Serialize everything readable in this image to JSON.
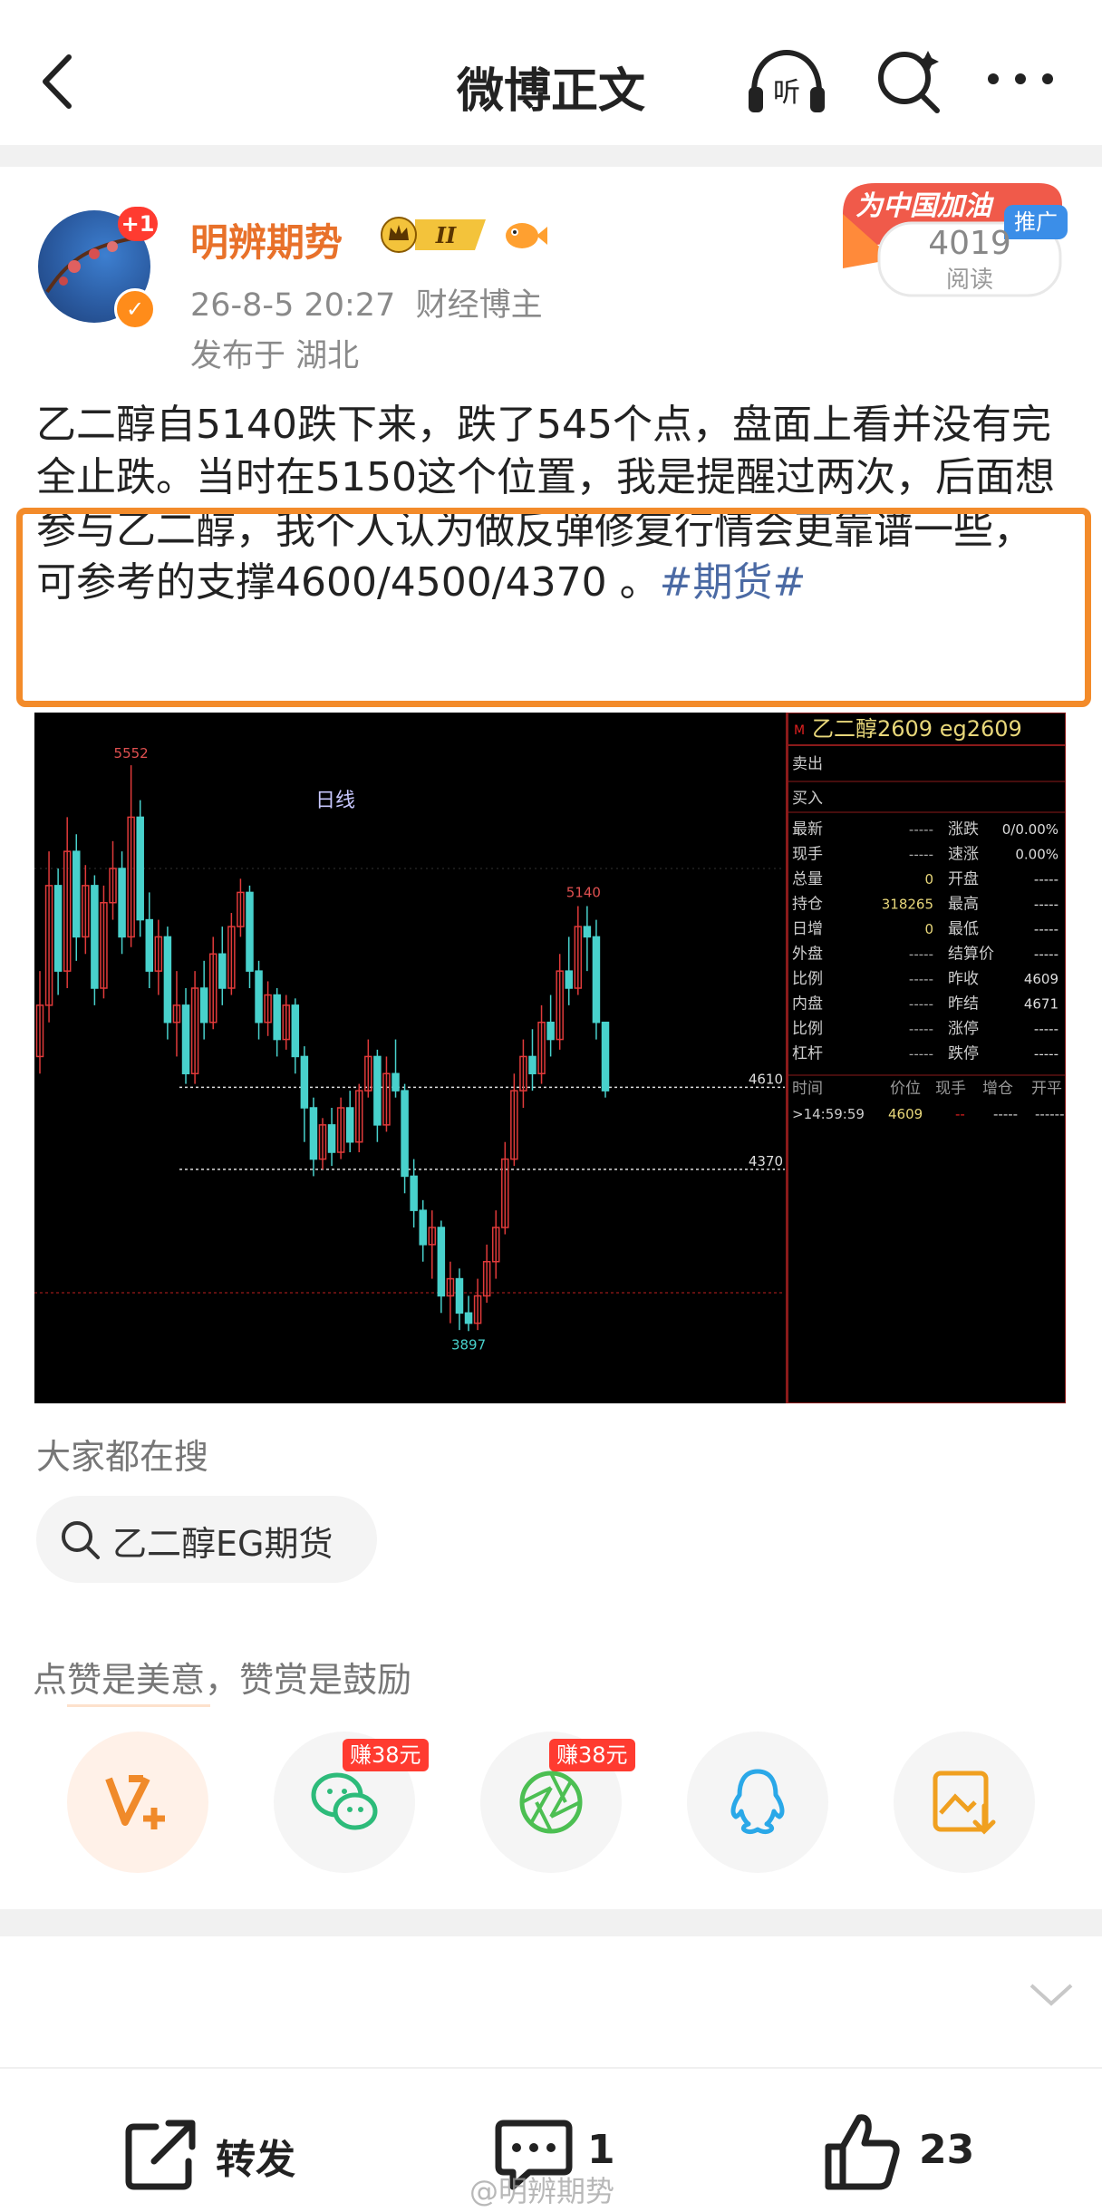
{
  "header": {
    "title": "微博正文",
    "listen_label": "听"
  },
  "author": {
    "name": "明辨期势",
    "avatar_badge": "+1",
    "level": "II",
    "timestamp": "26-8-5 20:27",
    "role": "财经博主",
    "location": "发布于 湖北"
  },
  "ad": {
    "title": "为中国加油",
    "tag": "推广",
    "reads": "4019",
    "reads_label": "阅读"
  },
  "post": {
    "text": "乙二醇自5140跌下来，跌了545个点，盘面上看并没有完全止跌。当时在5150这个位置，我是提醒过两次，后面想参与乙二醇，我个人认为做反弹修复行情会更靠谱一些，可参考的支撑4600/4500/4370 。",
    "hashtag": "#期货#"
  },
  "chart_data": {
    "type": "candlestick",
    "period_label": "日线",
    "annotations": {
      "high": "5552",
      "peak": "5140",
      "low": "3897"
    },
    "levels": [
      {
        "label": "4610",
        "value": 4610
      },
      {
        "label": "4370",
        "value": 4370
      }
    ],
    "candles": [
      {
        "o": 4700,
        "c": 4850,
        "h": 4950,
        "l": 4650
      },
      {
        "o": 4850,
        "c": 5200,
        "h": 5300,
        "l": 4800
      },
      {
        "o": 5200,
        "c": 4950,
        "h": 5250,
        "l": 4880
      },
      {
        "o": 4950,
        "c": 5300,
        "h": 5400,
        "l": 4900
      },
      {
        "o": 5300,
        "c": 5050,
        "h": 5350,
        "l": 4980
      },
      {
        "o": 5050,
        "c": 5200,
        "h": 5260,
        "l": 5000
      },
      {
        "o": 5200,
        "c": 4900,
        "h": 5230,
        "l": 4850
      },
      {
        "o": 4900,
        "c": 5150,
        "h": 5200,
        "l": 4870
      },
      {
        "o": 5150,
        "c": 5250,
        "h": 5330,
        "l": 5100
      },
      {
        "o": 5250,
        "c": 5050,
        "h": 5300,
        "l": 5000
      },
      {
        "o": 5050,
        "c": 5400,
        "h": 5552,
        "l": 5020
      },
      {
        "o": 5400,
        "c": 5100,
        "h": 5450,
        "l": 5050
      },
      {
        "o": 5100,
        "c": 4950,
        "h": 5180,
        "l": 4900
      },
      {
        "o": 4950,
        "c": 5050,
        "h": 5100,
        "l": 4880
      },
      {
        "o": 5050,
        "c": 4800,
        "h": 5080,
        "l": 4750
      },
      {
        "o": 4800,
        "c": 4850,
        "h": 4950,
        "l": 4700
      },
      {
        "o": 4850,
        "c": 4650,
        "h": 4900,
        "l": 4620
      },
      {
        "o": 4650,
        "c": 4900,
        "h": 4950,
        "l": 4620
      },
      {
        "o": 4900,
        "c": 4800,
        "h": 4980,
        "l": 4750
      },
      {
        "o": 4800,
        "c": 5000,
        "h": 5050,
        "l": 4780
      },
      {
        "o": 5000,
        "c": 4900,
        "h": 5080,
        "l": 4850
      },
      {
        "o": 4900,
        "c": 5080,
        "h": 5120,
        "l": 4880
      },
      {
        "o": 5080,
        "c": 5180,
        "h": 5220,
        "l": 5050
      },
      {
        "o": 5180,
        "c": 4950,
        "h": 5200,
        "l": 4900
      },
      {
        "o": 4950,
        "c": 4800,
        "h": 4980,
        "l": 4750
      },
      {
        "o": 4800,
        "c": 4880,
        "h": 4920,
        "l": 4760
      },
      {
        "o": 4880,
        "c": 4750,
        "h": 4900,
        "l": 4700
      },
      {
        "o": 4750,
        "c": 4850,
        "h": 4880,
        "l": 4720
      },
      {
        "o": 4850,
        "c": 4700,
        "h": 4870,
        "l": 4650
      },
      {
        "o": 4700,
        "c": 4550,
        "h": 4730,
        "l": 4450
      },
      {
        "o": 4550,
        "c": 4400,
        "h": 4580,
        "l": 4350
      },
      {
        "o": 4400,
        "c": 4500,
        "h": 4520,
        "l": 4370
      },
      {
        "o": 4500,
        "c": 4420,
        "h": 4550,
        "l": 4380
      },
      {
        "o": 4420,
        "c": 4550,
        "h": 4580,
        "l": 4400
      },
      {
        "o": 4550,
        "c": 4450,
        "h": 4600,
        "l": 4420
      },
      {
        "o": 4450,
        "c": 4600,
        "h": 4620,
        "l": 4420
      },
      {
        "o": 4600,
        "c": 4700,
        "h": 4750,
        "l": 4580
      },
      {
        "o": 4700,
        "c": 4500,
        "h": 4720,
        "l": 4450
      },
      {
        "o": 4500,
        "c": 4650,
        "h": 4700,
        "l": 4480
      },
      {
        "o": 4650,
        "c": 4600,
        "h": 4750,
        "l": 4580
      },
      {
        "o": 4600,
        "c": 4350,
        "h": 4620,
        "l": 4300
      },
      {
        "o": 4350,
        "c": 4250,
        "h": 4400,
        "l": 4200
      },
      {
        "o": 4250,
        "c": 4150,
        "h": 4280,
        "l": 4100
      },
      {
        "o": 4150,
        "c": 4200,
        "h": 4250,
        "l": 4050
      },
      {
        "o": 4200,
        "c": 4000,
        "h": 4220,
        "l": 3950
      },
      {
        "o": 4000,
        "c": 4050,
        "h": 4100,
        "l": 3920
      },
      {
        "o": 4050,
        "c": 3950,
        "h": 4080,
        "l": 3900
      },
      {
        "o": 3950,
        "c": 3920,
        "h": 4000,
        "l": 3897
      },
      {
        "o": 3920,
        "c": 4000,
        "h": 4050,
        "l": 3900
      },
      {
        "o": 4000,
        "c": 4100,
        "h": 4150,
        "l": 3980
      },
      {
        "o": 4100,
        "c": 4200,
        "h": 4250,
        "l": 4050
      },
      {
        "o": 4200,
        "c": 4400,
        "h": 4450,
        "l": 4180
      },
      {
        "o": 4400,
        "c": 4600,
        "h": 4650,
        "l": 4380
      },
      {
        "o": 4600,
        "c": 4700,
        "h": 4750,
        "l": 4550
      },
      {
        "o": 4700,
        "c": 4650,
        "h": 4780,
        "l": 4600
      },
      {
        "o": 4650,
        "c": 4800,
        "h": 4850,
        "l": 4620
      },
      {
        "o": 4800,
        "c": 4750,
        "h": 4880,
        "l": 4700
      },
      {
        "o": 4750,
        "c": 4950,
        "h": 5000,
        "l": 4720
      },
      {
        "o": 4950,
        "c": 4900,
        "h": 5050,
        "l": 4850
      },
      {
        "o": 4900,
        "c": 5080,
        "h": 5140,
        "l": 4880
      },
      {
        "o": 5080,
        "c": 5050,
        "h": 5140,
        "l": 4950
      },
      {
        "o": 5050,
        "c": 4800,
        "h": 5100,
        "l": 4750
      },
      {
        "o": 4800,
        "c": 4600,
        "h": 4700,
        "l": 4580
      }
    ],
    "quote_panel": {
      "header": "乙二醇2609  eg2609",
      "ask_label": "卖出",
      "bid_label": "买入",
      "rows": [
        {
          "l1": "最新",
          "v1": "-----",
          "l2": "涨跌",
          "v2": "0/0.00%"
        },
        {
          "l1": "现手",
          "v1": "-----",
          "l2": "速涨",
          "v2": "0.00%"
        },
        {
          "l1": "总量",
          "v1": "0",
          "l2": "开盘",
          "v2": "-----"
        },
        {
          "l1": "持仓",
          "v1": "318265",
          "l2": "最高",
          "v2": "-----"
        },
        {
          "l1": "日增",
          "v1": "0",
          "l2": "最低",
          "v2": "-----"
        },
        {
          "l1": "外盘",
          "v1": "-----",
          "l2": "结算价",
          "v2": "-----"
        },
        {
          "l1": "比例",
          "v1": "-----",
          "l2": "昨收",
          "v2": "4609"
        },
        {
          "l1": "内盘",
          "v1": "-----",
          "l2": "昨结",
          "v2": "4671"
        },
        {
          "l1": "比例",
          "v1": "-----",
          "l2": "涨停",
          "v2": "-----"
        },
        {
          "l1": "杠杆",
          "v1": "-----",
          "l2": "跌停",
          "v2": "-----"
        }
      ],
      "tick_headers": [
        "时间",
        "价位",
        "现手",
        "增仓",
        "开平"
      ],
      "tick_row": [
        "14:59:59",
        "4609",
        "--",
        "-----",
        "------"
      ]
    }
  },
  "hot_search": {
    "title": "大家都在搜",
    "query": "乙二醇EG期货"
  },
  "reward": {
    "title": "点赞是美意，赞赏是鼓励",
    "earn1": "赚38元",
    "earn2": "赚38元"
  },
  "bottom_bar": {
    "repost": "转发",
    "comments": "1",
    "likes": "23",
    "watermark": "@明辨期势"
  },
  "colors": {
    "accent": "#e8712a",
    "highlight_box": "#f38b2a",
    "tag": "#4b6aa4",
    "candle_up": "#e03a3a",
    "candle_down": "#48d1cc"
  }
}
